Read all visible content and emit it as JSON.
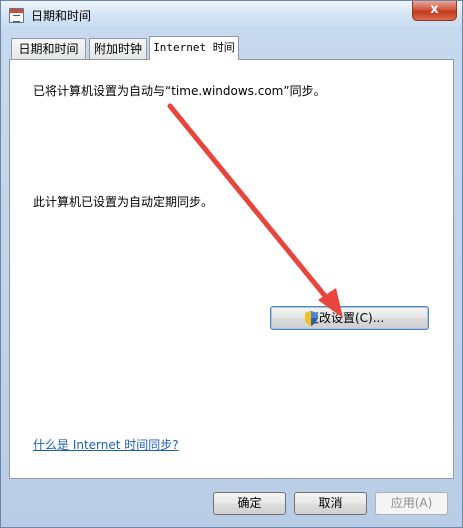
{
  "window": {
    "title": "日期和时间",
    "close_label": "x"
  },
  "tabs": [
    {
      "label": "日期和时间",
      "active": false
    },
    {
      "label": "附加时钟",
      "active": false
    },
    {
      "label": "Internet 时间",
      "active": true
    }
  ],
  "internet_time": {
    "sync_status": "已将计算机设置为自动与“time.windows.com”同步。",
    "schedule_status": "此计算机已设置为自动定期同步。",
    "change_settings_button": "更改设置(C)...",
    "help_link": "什么是 Internet 时间同步?"
  },
  "footer": {
    "ok_label": "确定",
    "cancel_label": "取消",
    "apply_label": "应用(A)"
  },
  "colors": {
    "annotation_arrow": "#e8453c",
    "link": "#1f5fb0"
  }
}
